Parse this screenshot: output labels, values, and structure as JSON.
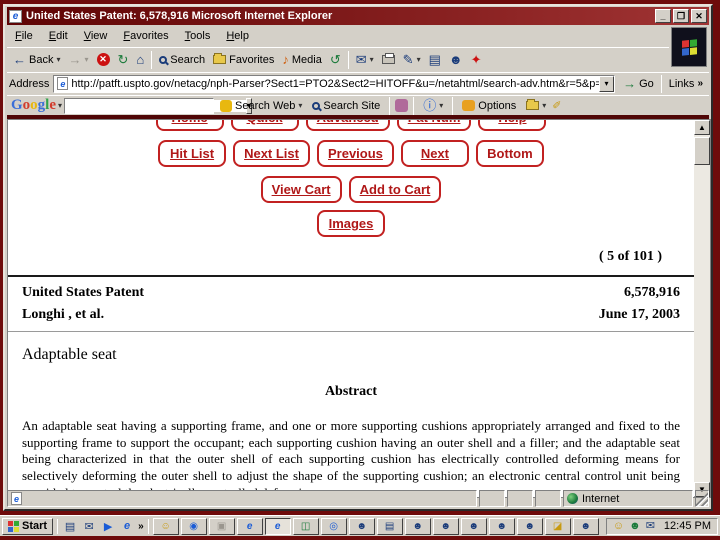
{
  "window": {
    "title": "United States Patent: 6,578,916   Microsoft Internet Explorer"
  },
  "menu": {
    "items": [
      "File",
      "Edit",
      "View",
      "Favorites",
      "Tools",
      "Help"
    ]
  },
  "toolbar": {
    "back_label": "Back",
    "search_label": "Search",
    "favorites_label": "Favorites",
    "media_label": "Media"
  },
  "address": {
    "label": "Address",
    "url": "http://patft.uspto.gov/netacg/nph-Parser?Sect1=PTO2&Sect2=HITOFF&u=/netahtml/search-adv.htm&r=5&p=1&f=G&l=50&",
    "go_label": "Go",
    "links_label": "Links"
  },
  "google": {
    "letters": [
      "G",
      "o",
      "o",
      "g",
      "l",
      "e"
    ],
    "search_value": "",
    "search_web_label": "Search Web",
    "search_site_label": "Search Site",
    "options_label": "Options"
  },
  "page": {
    "nav_row1": [
      "Home",
      "Quick",
      "Advanced",
      "Pat Num",
      "Help"
    ],
    "nav_row2": [
      "Hit List",
      "Next List",
      "Previous",
      "Next",
      "Bottom"
    ],
    "cart": [
      "View Cart",
      "Add to Cart"
    ],
    "images_label": "Images",
    "position": "( 5 of 101 )",
    "patent": {
      "name": "United States Patent",
      "number": "6,578,916",
      "inventor": "Longhi ,   et al.",
      "date": "June 17, 2003"
    },
    "title": "Adaptable seat",
    "abstract_heading": "Abstract",
    "abstract_text": "An adaptable seat having a supporting frame, and one or more supporting cushions appropriately arranged and fixed to the supporting frame to support the occupant; each supporting cushion having an outer shell and a filler; and the adaptable seat being characterized in that the outer shell of each supporting cushion has electrically controlled deforming means for selectively deforming the outer shell to adjust the shape of the supporting cushion; an electronic central control unit being provided to control the electrically controlled deforming means."
  },
  "statusbar": {
    "zone": "Internet"
  },
  "taskbar": {
    "start_label": "Start",
    "clock": "12:45 PM",
    "quicklaunch": [
      "▤",
      "✉",
      "▶",
      "e"
    ],
    "buttons": [
      "☺",
      "◉",
      "▣",
      "e",
      "e",
      "◫",
      "◎",
      "☻",
      "▤",
      "☻",
      "☻",
      "☻",
      "☻",
      "☻",
      "◪",
      "☻"
    ],
    "tray": [
      "☺",
      "☻",
      "✉"
    ]
  },
  "icons": {
    "back_arrow": "←",
    "forward_arrow": "→",
    "stop": "✕",
    "refresh": "↻",
    "home": "⌂",
    "media": "♪",
    "history": "↺",
    "mail": "✉",
    "edit": "✎",
    "discuss": "▤",
    "messenger": "☻",
    "fire": "✦",
    "dropdown": "▾",
    "chevron": "»",
    "go_arrow": "→",
    "minimize": "_",
    "maximize": "❐",
    "close": "✕",
    "info": "ⓘ",
    "pen": "✐",
    "ie_e": "e",
    "up_arrow": "▲",
    "down_arrow": "▼"
  },
  "colors": {
    "titlebar_left": "#5e0404",
    "titlebar_right": "#a03434",
    "page_link_red": "#b01818",
    "slide_background": "#6e0b0b",
    "chrome": "#d4d0c8"
  }
}
